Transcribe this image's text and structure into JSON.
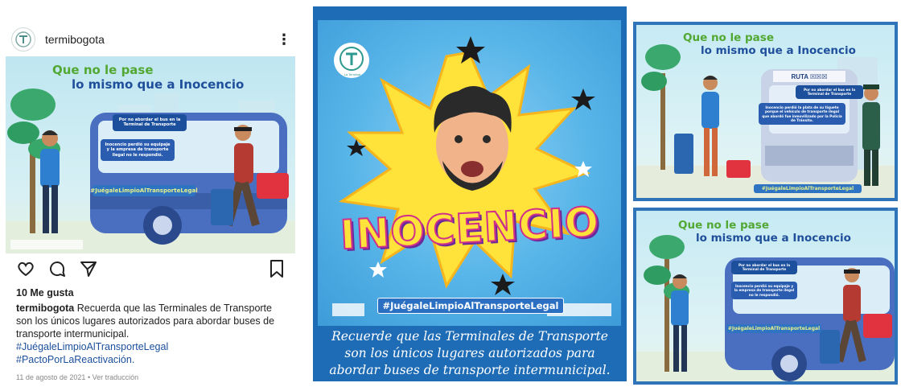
{
  "instagram": {
    "username": "termibogota",
    "likes": "10 Me gusta",
    "caption_user": "termibogota",
    "caption_text": "Recuerda que las Terminales de Transporte son los únicos lugares autorizados para abordar buses de transporte intermunicipal.",
    "hashtag_1": "#JuégaleLimpioAlTransporteLegal",
    "hashtag_2": "#PactoPorLaReactivación.",
    "date": "11 de agosto de 2021",
    "translate": "Ver traducción",
    "icons": [
      "profile-avatar-icon",
      "more-options-icon",
      "heart-icon",
      "comment-icon",
      "share-icon",
      "bookmark-icon"
    ]
  },
  "post_image": {
    "title_line1": "Que no le pase",
    "title_line2": "lo mismo que a Inocencio",
    "bubble_1": "Por no abordar el bus en la Terminal de Transporte",
    "bubble_2": "Inocencio perdió su equipaje y la empresa de transporte ilegal no le respondió.",
    "hashtag": "#JuégaleLimpioAlTransporteLegal"
  },
  "poster_middle": {
    "name_banner": "INOCENCIO",
    "hashtag": "#JuégaleLimpioAlTransporteLegal",
    "caption_line1": "Recuerde que las Terminales de Transporte",
    "caption_line2": "son los únicos lugares autorizados para",
    "caption_line3": "abordar buses de transporte intermunicipal.",
    "logo_label": "La Terminal"
  },
  "poster_right_top": {
    "title_line1": "Que no le pase",
    "title_line2": "lo mismo que a Inocencio",
    "bus_sign": "RUTA ☒☒☒",
    "bubble_1": "Por no abordar el bus en la Terminal de Transporte",
    "bubble_2": "Inocencio perdió la plata de su tiquete porque el vehículo de transporte ilegal que abordó fue inmovilizado por la Policía de Tránsito.",
    "hashtag": "#JuégaleLimpioAlTransporteLegal"
  },
  "poster_right_bottom": {
    "title_line1": "Que no le pase",
    "title_line2": "lo mismo que a Inocencio",
    "bubble_1": "Por no abordar el bus en la Terminal de Transporte",
    "bubble_2": "Inocencio perdió su equipaje y la empresa de transporte ilegal no le respondió.",
    "hashtag": "#JuégaleLimpioAlTransporteLegal"
  },
  "colors": {
    "title_green": "#52a832",
    "title_blue": "#1f4f9a",
    "poster_blue": "#1e6cb6",
    "bus_blue": "#4a6fc0",
    "comic_yellow": "#ffe23a",
    "hashtag_yellow": "#e8f18a"
  }
}
